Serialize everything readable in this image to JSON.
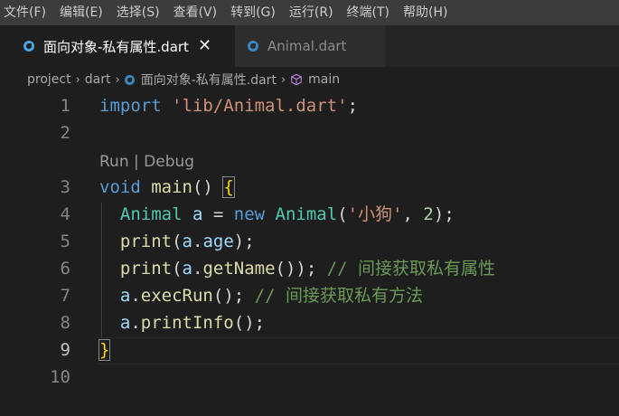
{
  "menubar": {
    "items": [
      "文件(F)",
      "编辑(E)",
      "选择(S)",
      "查看(V)",
      "转到(G)",
      "运行(R)",
      "终端(T)",
      "帮助(H)"
    ]
  },
  "tabs": [
    {
      "label": "面向对象-私有属性.dart",
      "active": true,
      "icon": "dart-icon"
    },
    {
      "label": "Animal.dart",
      "active": false,
      "icon": "dart-icon"
    }
  ],
  "breadcrumb": {
    "items": [
      "project",
      "dart",
      "面向对象-私有属性.dart",
      "main"
    ]
  },
  "editor": {
    "current_line": 9,
    "codelens": {
      "run": "Run",
      "sep": " | ",
      "debug": "Debug"
    },
    "lines": [
      {
        "n": "1",
        "tokens": [
          [
            "kw-blue",
            "import"
          ],
          [
            "plain",
            " "
          ],
          [
            "str",
            "'lib/Animal.dart'"
          ],
          [
            "plain",
            ";"
          ]
        ]
      },
      {
        "n": "2",
        "tokens": []
      },
      {
        "n": "3",
        "tokens": [
          [
            "kw-blue",
            "void"
          ],
          [
            "plain",
            " "
          ],
          [
            "fn",
            "main"
          ],
          [
            "plain",
            "() "
          ],
          [
            "brace-yellow",
            "{"
          ]
        ]
      },
      {
        "n": "4",
        "tokens": [
          [
            "plain",
            "  "
          ],
          [
            "type",
            "Animal"
          ],
          [
            "plain",
            " "
          ],
          [
            "var",
            "a"
          ],
          [
            "plain",
            " = "
          ],
          [
            "kw-blue",
            "new"
          ],
          [
            "plain",
            " "
          ],
          [
            "type",
            "Animal"
          ],
          [
            "plain",
            "("
          ],
          [
            "str",
            "'小狗'"
          ],
          [
            "plain",
            ", "
          ],
          [
            "num",
            "2"
          ],
          [
            "plain",
            ");"
          ]
        ]
      },
      {
        "n": "5",
        "tokens": [
          [
            "plain",
            "  "
          ],
          [
            "fn",
            "print"
          ],
          [
            "plain",
            "("
          ],
          [
            "var",
            "a"
          ],
          [
            "plain",
            "."
          ],
          [
            "var",
            "age"
          ],
          [
            "plain",
            ");"
          ]
        ]
      },
      {
        "n": "6",
        "tokens": [
          [
            "plain",
            "  "
          ],
          [
            "fn",
            "print"
          ],
          [
            "plain",
            "("
          ],
          [
            "var",
            "a"
          ],
          [
            "plain",
            "."
          ],
          [
            "fn",
            "getName"
          ],
          [
            "plain",
            "()); "
          ],
          [
            "cmt",
            "// 间接获取私有属性"
          ]
        ]
      },
      {
        "n": "7",
        "tokens": [
          [
            "plain",
            "  "
          ],
          [
            "var",
            "a"
          ],
          [
            "plain",
            "."
          ],
          [
            "fn",
            "execRun"
          ],
          [
            "plain",
            "(); "
          ],
          [
            "cmt",
            "// 间接获取私有方法"
          ]
        ]
      },
      {
        "n": "8",
        "tokens": [
          [
            "plain",
            "  "
          ],
          [
            "var",
            "a"
          ],
          [
            "plain",
            "."
          ],
          [
            "fn",
            "printInfo"
          ],
          [
            "plain",
            "();"
          ]
        ]
      },
      {
        "n": "9",
        "tokens": [
          [
            "brace-yellow",
            "}"
          ]
        ]
      },
      {
        "n": "10",
        "tokens": []
      }
    ]
  }
}
